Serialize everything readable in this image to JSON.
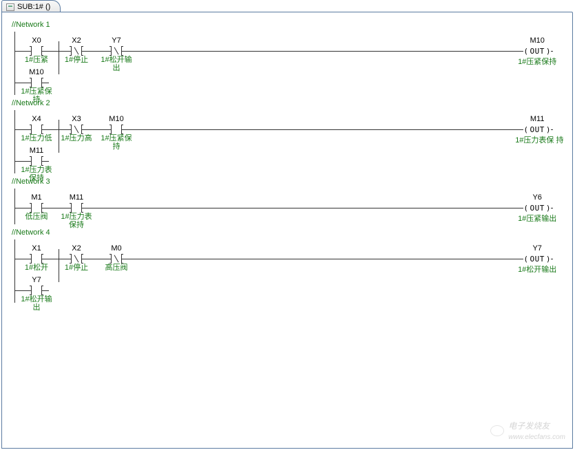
{
  "tab": {
    "title": "SUB:1# ()"
  },
  "networks": [
    {
      "label": "//Network 1",
      "row1": [
        {
          "addr": "X0",
          "desc": "1#压紧",
          "type": "no"
        },
        {
          "addr": "X2",
          "desc": "1#停止",
          "type": "nc"
        },
        {
          "addr": "Y7",
          "desc": "1#松开输\n出",
          "type": "nc"
        }
      ],
      "row2": [
        {
          "addr": "M10",
          "desc": "1#压紧保\n持",
          "type": "no"
        }
      ],
      "coil": {
        "addr": "M10",
        "text": "OUT",
        "desc": "1#压紧保持"
      }
    },
    {
      "label": "//Network 2",
      "row1": [
        {
          "addr": "X4",
          "desc": "1#压力低",
          "type": "no"
        },
        {
          "addr": "X3",
          "desc": "1#压力高",
          "type": "nc"
        },
        {
          "addr": "M10",
          "desc": "1#压紧保\n持",
          "type": "no"
        }
      ],
      "row2": [
        {
          "addr": "M11",
          "desc": "1#压力表\n保持",
          "type": "no"
        }
      ],
      "coil": {
        "addr": "M11",
        "text": "OUT",
        "desc": "1#压力表保\n持"
      }
    },
    {
      "label": "//Network 3",
      "row1": [
        {
          "addr": "M1",
          "desc": "低压阀",
          "type": "no"
        },
        {
          "addr": "M11",
          "desc": "1#压力表\n保持",
          "type": "no"
        }
      ],
      "row2": [],
      "coil": {
        "addr": "Y6",
        "text": "OUT",
        "desc": "1#压紧输出"
      }
    },
    {
      "label": "//Network 4",
      "row1": [
        {
          "addr": "X1",
          "desc": "1#松开",
          "type": "no"
        },
        {
          "addr": "X2",
          "desc": "1#停止",
          "type": "nc"
        },
        {
          "addr": "M0",
          "desc": "高压阀",
          "type": "nc"
        }
      ],
      "row2": [
        {
          "addr": "Y7",
          "desc": "1#松开输\n出",
          "type": "no"
        }
      ],
      "coil": {
        "addr": "Y7",
        "text": "OUT",
        "desc": "1#松开输出"
      }
    }
  ],
  "watermark": {
    "brand": "电子发烧友",
    "url": "www.elecfans.com"
  }
}
